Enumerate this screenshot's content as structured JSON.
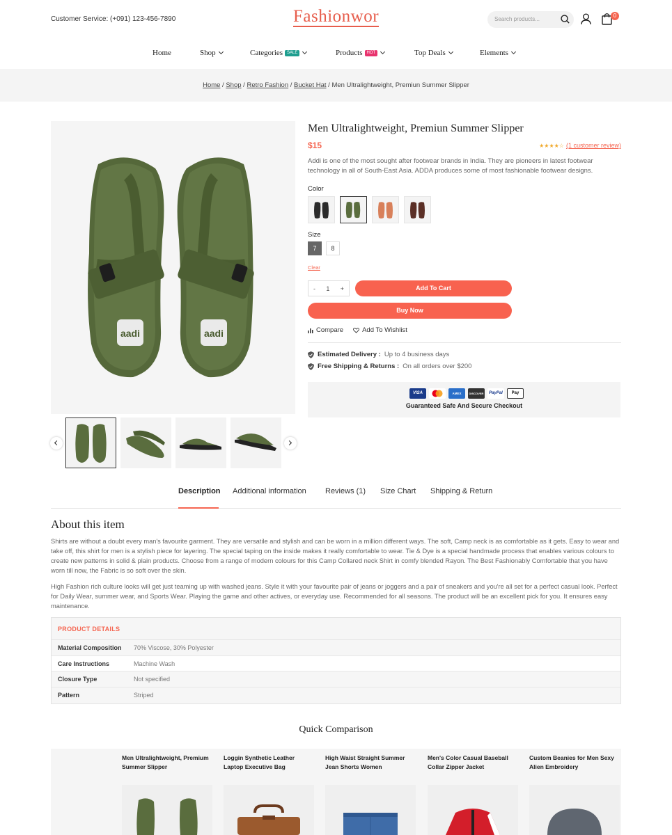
{
  "header": {
    "customer_service": "Customer Service: (+091) 123-456-7890",
    "logo": "Fashionwor",
    "search_placeholder": "Search products...",
    "cart_count": "0"
  },
  "nav": [
    {
      "label": "Home"
    },
    {
      "label": "Shop"
    },
    {
      "label": "Categories",
      "tag": "SALE",
      "tag_color": "#1e9e8f"
    },
    {
      "label": "Products",
      "tag": "HOT",
      "tag_color": "#e8336e"
    },
    {
      "label": "Top Deals"
    },
    {
      "label": "Elements"
    }
  ],
  "breadcrumb": {
    "home": "Home",
    "shop": "Shop",
    "retro": "Retro Fashion",
    "bucket": "Bucket Hat",
    "current": "Men Ultralightweight, Premiun Summer Slipper",
    "sep": " / "
  },
  "product": {
    "title": "Men Ultralightweight, Premiun Summer Slipper",
    "price": "$15",
    "stars": "★★★★☆",
    "review_link": "(1 customer review)",
    "description": "Addi is one of the most sought after footwear brands in India. They are pioneers in latest footwear technology in all of South-East Asia. ADDA produces some of most fashionable footwear designs.",
    "color_label": "Color",
    "colors": [
      "black",
      "green",
      "orange",
      "brown"
    ],
    "size_label": "Size",
    "sizes": [
      "7",
      "8"
    ],
    "clear": "Clear",
    "qty_minus": "-",
    "qty": "1",
    "qty_plus": "+",
    "add_to_cart": "Add To Cart",
    "buy_now": "Buy Now",
    "compare": "Compare",
    "wishlist": "Add To Wishlist",
    "delivery_label": "Estimated Delivery :",
    "delivery_value": "Up to 4 business days",
    "shipping_label": "Free Shipping & Returns :",
    "shipping_value": "On all orders over $200",
    "cards": [
      "VISA",
      "MC",
      "AMEX",
      "DISCOVER",
      "PayPal",
      "Pay"
    ],
    "guarantee": "Guaranteed Safe And Secure Checkout",
    "image_brand": "aadi"
  },
  "tabs": [
    {
      "label": "Description"
    },
    {
      "label": "Additional information"
    },
    {
      "label": "Reviews (1)"
    },
    {
      "label": "Size Chart"
    },
    {
      "label": "Shipping & Return"
    }
  ],
  "about": {
    "heading": "About this item",
    "p1": "Shirts are without a doubt every man's favourite garment. They are versatile and stylish and can be worn in a million different ways. The soft, Camp neck is as comfortable as it gets. Easy to wear and take off, this shirt for men is a stylish piece for layering. The special taping on the inside makes it really comfortable to wear. Tie & Dye is a special handmade process that enables various colours to create new patterns in solid & plain products. Choose from a range of modern colours for this Camp Collared neck Shirt in comfy blended Rayon. The Best Fashionably Comfortable that you have worn till now, the Fabric is so soft over the skin.",
    "p2": "High Fashion rich culture looks will get just teaming up with washed jeans. Style it with your favourite pair of jeans or joggers and a pair of sneakers and you're all set for a perfect casual look. Perfect for Daily Wear, summer wear, and Sports Wear. Playing the game and other actives, or everyday use. Recommended for all seasons. The product will be an excellent pick for you. It ensures easy maintenance."
  },
  "details": {
    "heading": "PRODUCT DETAILS",
    "rows": [
      {
        "k": "Material Composition",
        "v": "70% Viscose, 30% Polyester"
      },
      {
        "k": "Care Instructions",
        "v": "Machine Wash"
      },
      {
        "k": "Closure Type",
        "v": "Not specified"
      },
      {
        "k": "Pattern",
        "v": "Striped"
      }
    ]
  },
  "comparison": {
    "title": "Quick Comparison",
    "items": [
      {
        "name": "Men Ultralightweight, Premium Summer Slipper"
      },
      {
        "name": "Loggin Synthetic Leather Laptop Executive Bag"
      },
      {
        "name": "High Waist Straight Summer Jean Shorts Women"
      },
      {
        "name": "Men's Color Casual Baseball Collar Zipper Jacket"
      },
      {
        "name": "Custom Beanies for Men Sexy Alien Embroidery"
      }
    ]
  }
}
